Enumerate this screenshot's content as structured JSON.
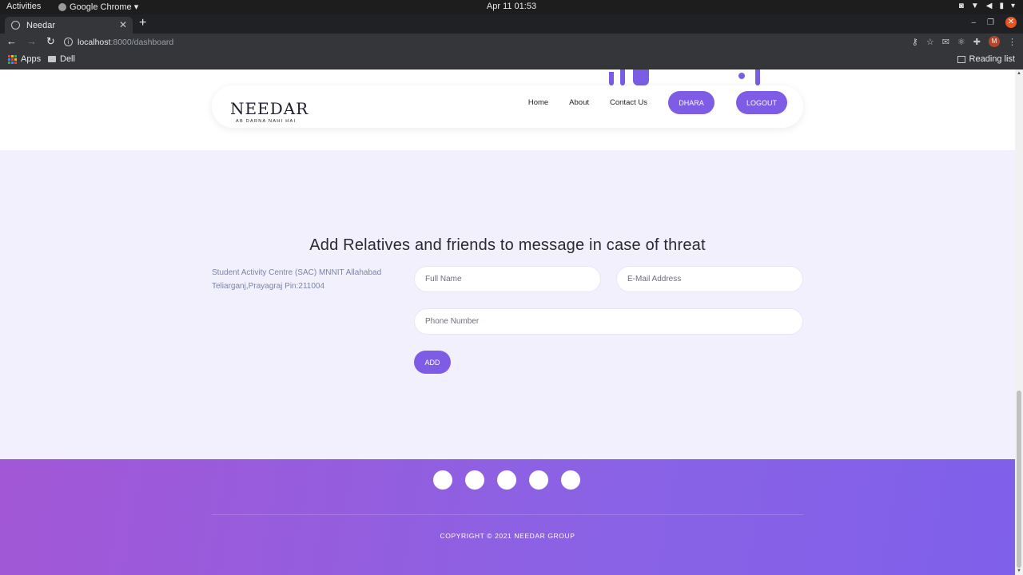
{
  "os": {
    "activities": "Activities",
    "app_name": "Google Chrome ▾",
    "clock": "Apr 11  01:53"
  },
  "browser": {
    "tab_title": "Needar",
    "tab_close": "✕",
    "new_tab": "+",
    "url_host": "localhost",
    "url_rest": ":8000/dashboard",
    "bookmarks": {
      "apps": "Apps",
      "dell": "Dell",
      "reading_list": "Reading list"
    },
    "profile_initial": "M"
  },
  "header": {
    "logo_name": "NEEDAR",
    "logo_tagline": "AB DARNA NAHI HAI",
    "nav": {
      "home": "Home",
      "about": "About",
      "contact": "Contact Us"
    },
    "user_button": "DHARA",
    "logout_button": "LOGOUT"
  },
  "form": {
    "heading": "Add Relatives and friends to message in case of threat",
    "address_line1": "Student Activity Centre (SAC) MNNIT Allahabad",
    "address_line2": "Teliarganj,Prayagraj Pin:211004",
    "full_name_placeholder": "Full Name",
    "email_placeholder": "E-Mail Address",
    "phone_placeholder": "Phone Number",
    "add_button": "ADD"
  },
  "footer": {
    "social_icons": [
      "facebook-icon",
      "twitter-icon",
      "instagram-icon",
      "linkedin-icon",
      "github-icon"
    ],
    "social_glyph": "",
    "copyright": "COPYRIGHT © 2021 NEEDAR GROUP"
  },
  "colors": {
    "accent": "#7f5ce5",
    "section_bg": "#f1f0fc",
    "footer_start": "#a257d6",
    "footer_end": "#7f60ea"
  }
}
